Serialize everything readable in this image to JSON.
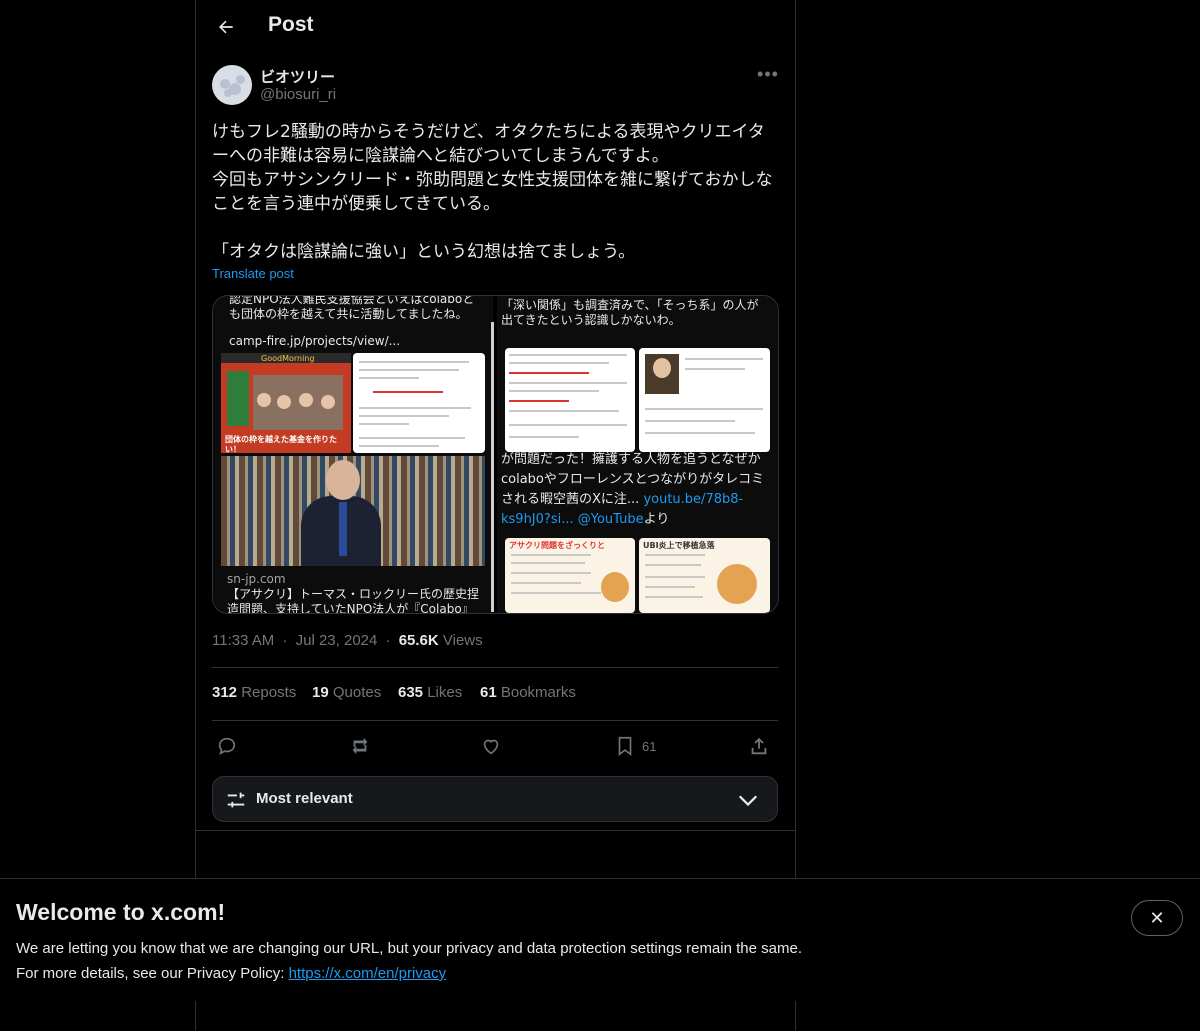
{
  "header": {
    "back_label": "←",
    "title": "Post"
  },
  "author": {
    "name": "ビオツリー",
    "handle": "@biosuri_ri"
  },
  "tweet": {
    "text": "けもフレ2騒動の時からそうだけど、オタクたちによる表現やクリエイターへの非難は容易に陰謀論へと結びついてしまうんですよ。\n今回もアサシンクリード・弥助問題と女性支援団体を雑に繋げておかしなことを言う連中が便乗してきている。\n\n「オタクは陰謀論に強い」という幻想は捨てましょう。",
    "translate_label": "Translate post"
  },
  "media": {
    "left": {
      "top_text": "認定NPO法人難民支援協会といえばcolaboとも団体の枠を越えて共に活動してましたね。",
      "link": "camp-fire.jp/projects/view/...",
      "poster_brand": "GoodMorning",
      "poster_caption": "団体の枠を越えた基金を作りたい！",
      "source": "sn-jp.com",
      "bottom_text": "【アサクリ】トーマス・ロックリー氏の歴史捏造問題、支持していたNPO法人が『Colabo』と繋がっ"
    },
    "right": {
      "top_text": "「深い関係」も調査済みで、「そっち系」の人が出てきたという認識しかないわ。",
      "mid_text_prefix": "が問題だった！擁護する人物を追うとなぜかcolaboやフローレンスとつながりがタレコミされる暇空茜のXに注...",
      "mid_link1": "youtu.be/78b8-ks9hJ0?si...",
      "mid_link2": "@YouTube",
      "mid_suffix": "より",
      "panel1_title": "アサクリ問題をざっくりと",
      "panel2_title": "UBI炎上で移植急落"
    }
  },
  "meta": {
    "time": "11:33 AM",
    "date": "Jul 23, 2024",
    "views_count": "65.6K",
    "views_label": "Views",
    "sep": "·"
  },
  "stats": {
    "reposts_count": "312",
    "reposts_label": "Reposts",
    "quotes_count": "19",
    "quotes_label": "Quotes",
    "likes_count": "635",
    "likes_label": "Likes",
    "bookmarks_count": "61",
    "bookmarks_label": "Bookmarks"
  },
  "actions": {
    "bookmark_count": "61"
  },
  "filter": {
    "label": "Most relevant"
  },
  "banner": {
    "title": "Welcome to x.com!",
    "line1": "We are letting you know that we are changing our URL, but your privacy and data protection settings remain the same.",
    "line2_prefix": "For more details, see our Privacy Policy: ",
    "line2_link": "https://x.com/en/privacy",
    "close_label": "✕"
  },
  "colors": {
    "background": "#000000",
    "text": "#e7e9ea",
    "secondary": "#71767b",
    "link": "#1d9bf0",
    "border": "#2f3336"
  }
}
